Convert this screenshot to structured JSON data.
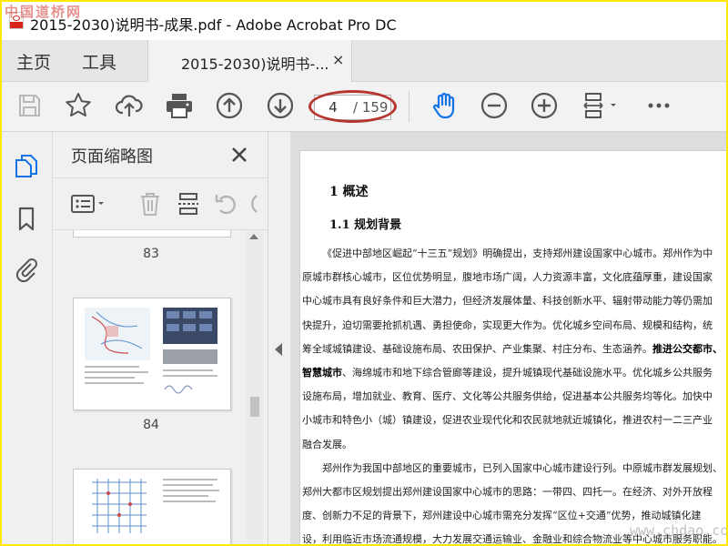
{
  "window": {
    "title": "2015-2030)说明书-成果.pdf - Adobe Acrobat Pro DC",
    "watermark_top": "中国道桥网",
    "watermark_bottom": "www.chdao.com"
  },
  "tabs": {
    "home": "主页",
    "tools": "工具",
    "document": "2015-2030)说明书-...",
    "close_glyph": "×"
  },
  "toolbar": {
    "page_current": "4",
    "page_total": "/ 159",
    "icons": [
      "save-icon",
      "star-icon",
      "cloud-upload-icon",
      "print-icon",
      "page-up-icon",
      "page-down-icon",
      "hand-tool-icon",
      "zoom-out-icon",
      "zoom-in-icon",
      "fit-page-icon",
      "more-icon"
    ]
  },
  "panel": {
    "title": "页面缩略图",
    "thumbnails": [
      {
        "label": "83"
      },
      {
        "label": "84"
      }
    ]
  },
  "document": {
    "heading1": "1 概述",
    "heading2": "1.1  规划背景",
    "lines": [
      {
        "indent": true,
        "segments": [
          {
            "text": "《促进中部地区崛起“十三五”规划》明确提出，支持郑州建设国家中心城市。郑州作为中",
            "bold": false
          }
        ]
      },
      {
        "indent": false,
        "segments": [
          {
            "text": "原城市群核心城市，区位优势明显，腹地市场广阔，人力资源丰富，文化底蕴厚重，建设国家",
            "bold": false
          }
        ]
      },
      {
        "indent": false,
        "segments": [
          {
            "text": "中心城市具有良好条件和巨大潜力，但经济发展体量、科技创新水平、辐射带动能力等仍需加",
            "bold": false
          }
        ]
      },
      {
        "indent": false,
        "segments": [
          {
            "text": "快提升，迫切需要抢抓机遇、勇担使命，实现更大作为。优化城乡空间布局、规模和结构，统",
            "bold": false
          }
        ]
      },
      {
        "indent": false,
        "segments": [
          {
            "text": "筹全域城镇建设、基础设施布局、农田保护、产业集聚、村庄分布、生态涵养。",
            "bold": false
          },
          {
            "text": "推进公交都市、",
            "bold": true
          }
        ]
      },
      {
        "indent": false,
        "segments": [
          {
            "text": "智慧城市",
            "bold": true
          },
          {
            "text": "、海绵城市和地下综合管廊等建设，提升城镇现代基础设施水平。优化城乡公共服务",
            "bold": false
          }
        ]
      },
      {
        "indent": false,
        "segments": [
          {
            "text": "设施布局，增加就业、教育、医疗、文化等公共服务供给，促进基本公共服务均等化。加快中",
            "bold": false
          }
        ]
      },
      {
        "indent": false,
        "segments": [
          {
            "text": "小城市和特色小（城）镇建设，促进农业现代化和农民就地就近城镇化，推进农村一二三产业",
            "bold": false
          }
        ]
      },
      {
        "indent": false,
        "segments": [
          {
            "text": "融合发展。",
            "bold": false
          }
        ]
      },
      {
        "indent": true,
        "segments": [
          {
            "text": "郑州作为我国中部地区的重要城市，已列入国家中心城市建设行列。中原城市群发展规划、",
            "bold": false
          }
        ]
      },
      {
        "indent": false,
        "segments": [
          {
            "text": "郑州大都市区规划提出郑州建设国家中心城市的思路：一带四、四托一。在经济、对外开放程",
            "bold": false
          }
        ]
      },
      {
        "indent": false,
        "segments": [
          {
            "text": "度、创新力不足的背景下，郑州建设中心城市需充分发挥“区位+交通”优势，推动城镇化建",
            "bold": false
          }
        ]
      },
      {
        "indent": false,
        "segments": [
          {
            "text": "设，利用临近市场流通规模，大力发展交通运输业、金融业和综合物流业等中心城市服务职能。",
            "bold": false
          }
        ]
      }
    ]
  },
  "colors": {
    "frame": "#ffe900",
    "accent_red": "#b5362f",
    "hand_tool_blue": "#1473e6",
    "icon_gray": "#555555"
  }
}
